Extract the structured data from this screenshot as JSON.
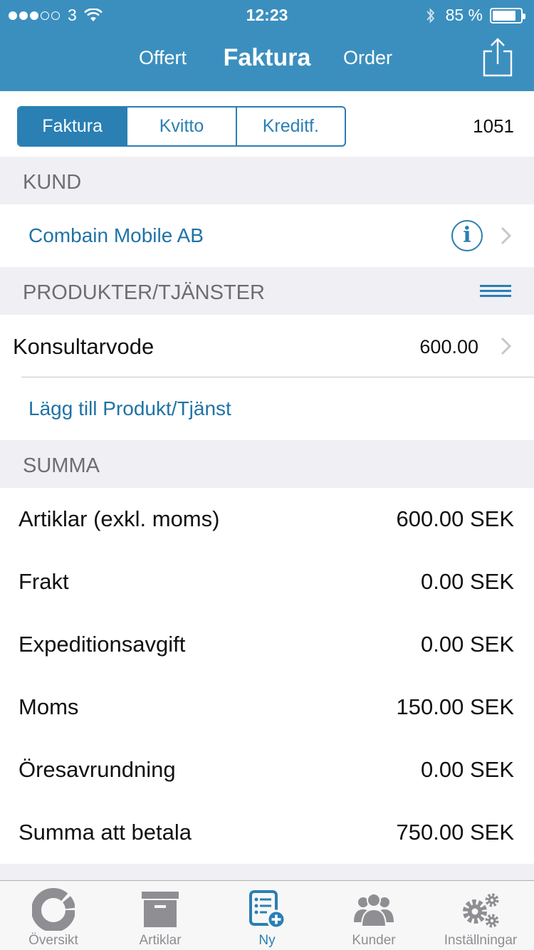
{
  "status_bar": {
    "carrier": "3",
    "time": "12:23",
    "battery": "85 %",
    "battery_level": 0.85
  },
  "nav": {
    "left_tab": "Offert",
    "title": "Faktura",
    "right_tab": "Order"
  },
  "doc_type": {
    "segments": [
      "Faktura",
      "Kvitto",
      "Kreditf."
    ],
    "selected": "Faktura",
    "invoice_number": "1051"
  },
  "customer": {
    "section_title": "KUND",
    "name": "Combain Mobile AB"
  },
  "products": {
    "section_title": "PRODUKTER/TJÄNSTER",
    "items": [
      {
        "name": "Konsultarvode",
        "price": "600.00"
      }
    ],
    "add_label": "Lägg till Produkt/Tjänst"
  },
  "summary": {
    "section_title": "SUMMA",
    "rows": [
      {
        "label": "Artiklar (exkl. moms)",
        "value": "600.00 SEK"
      },
      {
        "label": "Frakt",
        "value": "0.00 SEK"
      },
      {
        "label": "Expeditionsavgift",
        "value": "0.00 SEK"
      },
      {
        "label": "Moms",
        "value": "150.00 SEK"
      },
      {
        "label": "Öresavrundning",
        "value": "0.00 SEK"
      },
      {
        "label": "Summa att betala",
        "value": "750.00 SEK"
      }
    ]
  },
  "tabbar": {
    "items": [
      {
        "label": "Översikt",
        "icon": "pie-chart-icon"
      },
      {
        "label": "Artiklar",
        "icon": "archive-box-icon"
      },
      {
        "label": "Ny",
        "icon": "new-document-icon"
      },
      {
        "label": "Kunder",
        "icon": "users-icon"
      },
      {
        "label": "Inställningar",
        "icon": "gear-icon"
      }
    ],
    "active": "Ny"
  },
  "colors": {
    "brand": "#3b8fbe",
    "accent": "#2a7fb3",
    "link": "#1f73a6",
    "section_background": "#efeff4",
    "tab_inactive": "#8e8e93"
  }
}
